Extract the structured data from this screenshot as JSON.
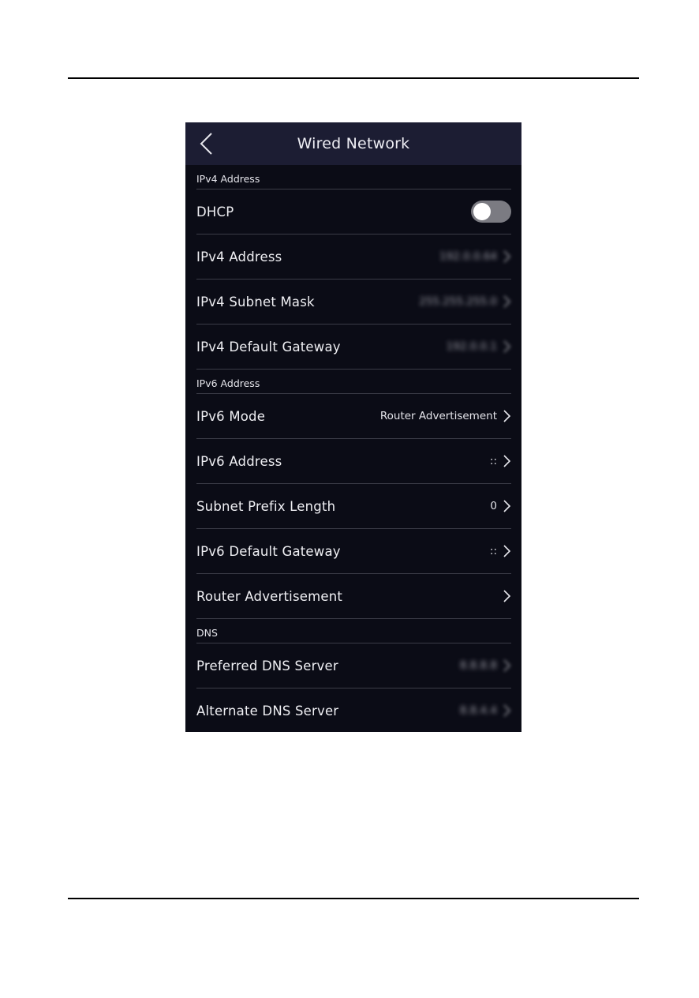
{
  "window": {
    "title": "Wired Network"
  },
  "icons": {
    "back": "back-chevron-icon",
    "row_arrow": "chevron-right-icon"
  },
  "colors": {
    "titlebar_bg": "#1c1d33",
    "screen_bg": "#0b0c16",
    "divider": "#3b3c47",
    "toggle_off": "#7b7b82"
  },
  "sections": {
    "ipv4": {
      "header": "IPv4 Address",
      "dhcp": {
        "label": "DHCP",
        "enabled": false
      },
      "address": {
        "label": "IPv4 Address",
        "value": "192.0.0.64",
        "obscured": true
      },
      "subnet_mask": {
        "label": "IPv4 Subnet Mask",
        "value": "255.255.255.0",
        "obscured": true
      },
      "gateway": {
        "label": "IPv4 Default Gateway",
        "value": "192.0.0.1",
        "obscured": true
      }
    },
    "ipv6": {
      "header": "IPv6 Address",
      "mode": {
        "label": "IPv6 Mode",
        "value": "Router Advertisement"
      },
      "address": {
        "label": "IPv6 Address",
        "value": "::"
      },
      "prefix_length": {
        "label": "Subnet Prefix Length",
        "value": "0"
      },
      "gateway": {
        "label": "IPv6 Default Gateway",
        "value": "::"
      },
      "router_advertisement": {
        "label": "Router Advertisement",
        "value": ""
      }
    },
    "dns": {
      "header": "DNS",
      "preferred": {
        "label": "Preferred DNS Server",
        "value": "8.8.8.8",
        "obscured": true
      },
      "alternate": {
        "label": "Alternate DNS Server",
        "value": "8.8.4.4",
        "obscured": true
      }
    }
  }
}
